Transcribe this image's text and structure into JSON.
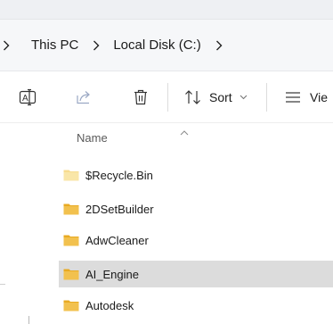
{
  "breadcrumb": {
    "items": [
      "This PC",
      "Local Disk (C:)"
    ]
  },
  "toolbar": {
    "sort_label": "Sort",
    "view_label": "Vie"
  },
  "file_list": {
    "column_name": "Name",
    "items": [
      {
        "name": "$Recycle.Bin",
        "selected": false
      },
      {
        "name": "2DSetBuilder",
        "selected": false
      },
      {
        "name": "AdwCleaner",
        "selected": false
      },
      {
        "name": "AI_Engine",
        "selected": true
      },
      {
        "name": "Autodesk",
        "selected": false
      }
    ]
  },
  "colors": {
    "folder": "#f2c14e",
    "folder_light": "#f7dc8f",
    "selected_row": "#dcdcdc",
    "accent_icon": "#6b8fbf"
  }
}
